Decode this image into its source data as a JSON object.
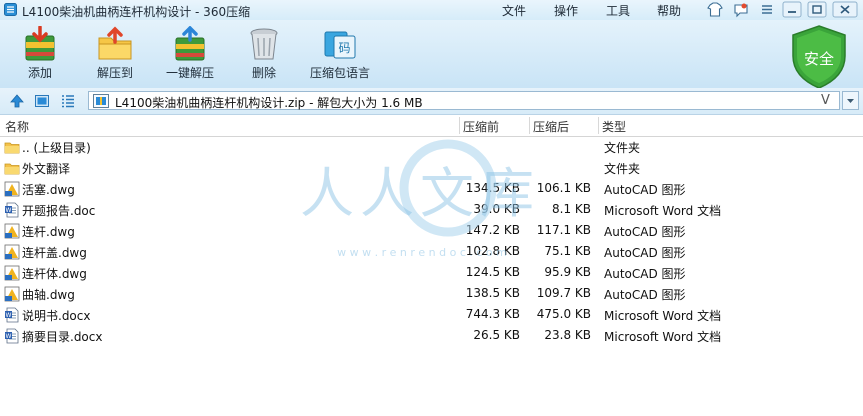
{
  "window": {
    "title": "L4100柴油机曲柄连杆机构设计 - 360压缩",
    "menu": [
      "文件",
      "操作",
      "工具",
      "帮助"
    ]
  },
  "toolbar": {
    "items": [
      {
        "label": "添加",
        "icon": "add-archive-icon"
      },
      {
        "label": "解压到",
        "icon": "extract-to-icon"
      },
      {
        "label": "一键解压",
        "icon": "one-click-extract-icon"
      },
      {
        "label": "删除",
        "icon": "trash-can-icon"
      },
      {
        "label": "压缩包语言",
        "icon": "archive-language-icon"
      }
    ],
    "security_label": "安全"
  },
  "address": {
    "path": "L4100柴油机曲柄连杆机构设计.zip - 解包大小为 1.6 MB"
  },
  "columns": {
    "name": "名称",
    "size": "压缩前",
    "packed": "压缩后",
    "type": "类型"
  },
  "files": [
    {
      "name": ".. (上级目录)",
      "size": "",
      "packed": "",
      "type": "文件夹",
      "icon": "folder-icon"
    },
    {
      "name": "外文翻译",
      "size": "",
      "packed": "",
      "type": "文件夹",
      "icon": "folder-icon"
    },
    {
      "name": "活塞.dwg",
      "size": "134.5 KB",
      "packed": "106.1 KB",
      "type": "AutoCAD 图形",
      "icon": "dwg-file-icon"
    },
    {
      "name": "开题报告.doc",
      "size": "39.0 KB",
      "packed": "8.1 KB",
      "type": "Microsoft Word 文档",
      "icon": "word-file-icon"
    },
    {
      "name": "连杆.dwg",
      "size": "147.2 KB",
      "packed": "117.1 KB",
      "type": "AutoCAD 图形",
      "icon": "dwg-file-icon"
    },
    {
      "name": "连杆盖.dwg",
      "size": "102.8 KB",
      "packed": "75.1 KB",
      "type": "AutoCAD 图形",
      "icon": "dwg-file-icon"
    },
    {
      "name": "连杆体.dwg",
      "size": "124.5 KB",
      "packed": "95.9 KB",
      "type": "AutoCAD 图形",
      "icon": "dwg-file-icon"
    },
    {
      "name": "曲轴.dwg",
      "size": "138.5 KB",
      "packed": "109.7 KB",
      "type": "AutoCAD 图形",
      "icon": "dwg-file-icon"
    },
    {
      "name": "说明书.docx",
      "size": "744.3 KB",
      "packed": "475.0 KB",
      "type": "Microsoft Word 文档",
      "icon": "word-file-icon"
    },
    {
      "name": "摘要目录.docx",
      "size": "26.5 KB",
      "packed": "23.8 KB",
      "type": "Microsoft Word 文档",
      "icon": "word-file-icon"
    }
  ],
  "watermark": {
    "text": "人人文库",
    "url": "w w w . r e n r e n d o c . c o m"
  }
}
